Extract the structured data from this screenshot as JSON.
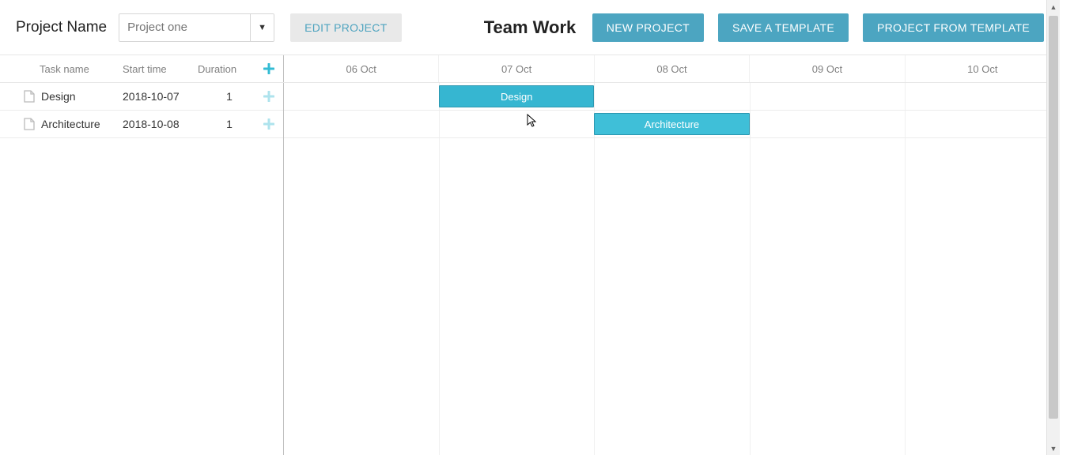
{
  "header": {
    "project_label": "Project Name",
    "project_select_placeholder": "Project one",
    "edit_label": "EDIT PROJECT",
    "title": "Team Work",
    "new_project_label": "NEW PROJECT",
    "save_template_label": "SAVE A TEMPLATE",
    "project_from_template_label": "PROJECT FROM TEMPLATE"
  },
  "columns": {
    "task": "Task name",
    "start": "Start time",
    "duration": "Duration"
  },
  "timeline_headers": [
    "06 Oct",
    "07 Oct",
    "08 Oct",
    "09 Oct",
    "10 Oct"
  ],
  "tasks": [
    {
      "name": "Design",
      "start": "2018-10-07",
      "duration": "1"
    },
    {
      "name": "Architecture",
      "start": "2018-10-08",
      "duration": "1"
    }
  ],
  "bars": [
    {
      "label": "Design"
    },
    {
      "label": "Architecture"
    }
  ]
}
